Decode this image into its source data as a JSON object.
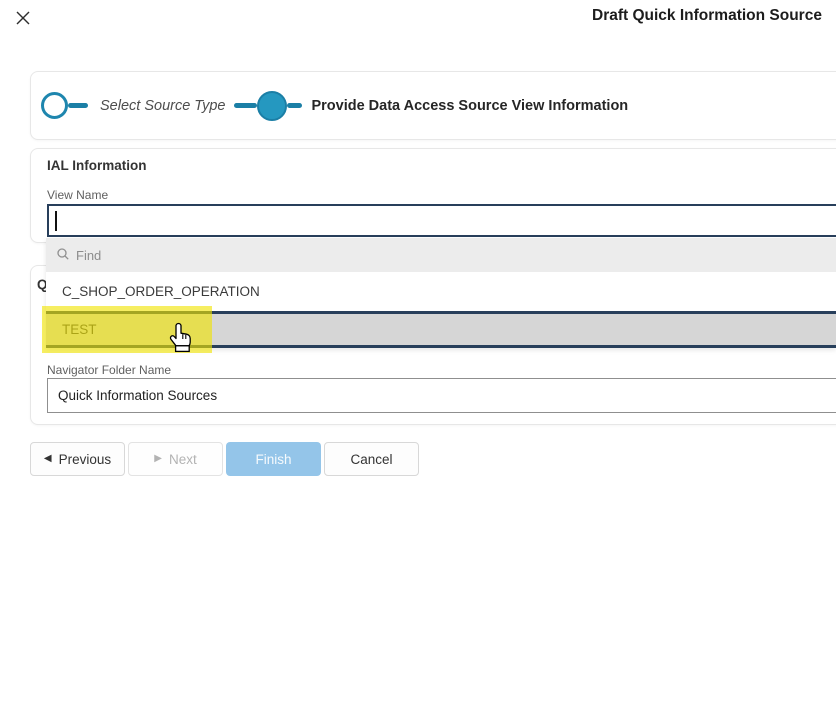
{
  "window": {
    "title": "Draft Quick Information Source"
  },
  "icons": {
    "close": "✕",
    "previous_arrow": "◀",
    "next_arrow": "▶",
    "search": "magnifier"
  },
  "stepper": {
    "accent_color": "#2598c0",
    "steps": [
      {
        "label": "Select Source Type",
        "state": "visited"
      },
      {
        "label": "Provide Data Access Source View Information",
        "state": "current"
      }
    ]
  },
  "ial_section": {
    "heading": "IAL Information",
    "view_name": {
      "label": "View Name",
      "value": "",
      "focused": true
    }
  },
  "details_section": {
    "heading_partial": "Q",
    "navigator_folder": {
      "label": "Navigator Folder Name",
      "value": "Quick Information Sources"
    }
  },
  "dropdown": {
    "find_placeholder": "Find",
    "options": [
      {
        "label": "C_SHOP_ORDER_OPERATION",
        "state": "normal"
      },
      {
        "label": "TEST",
        "state": "focused-highlighted"
      }
    ],
    "highlight_color": "#f0e400"
  },
  "buttons": {
    "previous": "Previous",
    "next": "Next",
    "finish": "Finish",
    "cancel": "Cancel"
  }
}
